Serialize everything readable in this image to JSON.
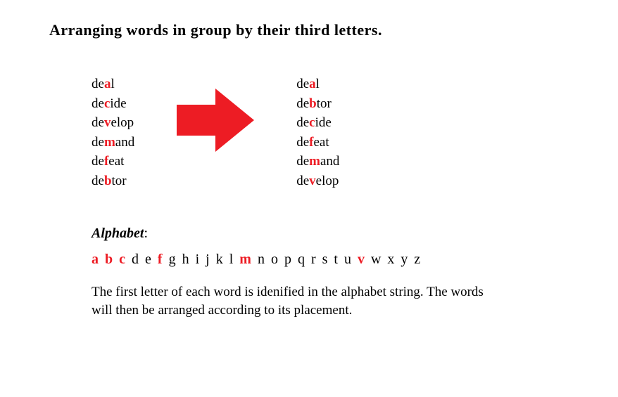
{
  "title": "Arranging words in group by their  third  letters.",
  "highlight_color": "#ED1C24",
  "left_words": [
    {
      "pre": "de",
      "hl": "a",
      "post": "l"
    },
    {
      "pre": "de",
      "hl": "c",
      "post": "ide"
    },
    {
      "pre": "de",
      "hl": "v",
      "post": "elop"
    },
    {
      "pre": "de",
      "hl": "m",
      "post": "and"
    },
    {
      "pre": "de",
      "hl": "f",
      "post": "eat"
    },
    {
      "pre": "de",
      "hl": "b",
      "post": "tor"
    }
  ],
  "right_words": [
    {
      "pre": "de",
      "hl": "a",
      "post": "l"
    },
    {
      "pre": "de",
      "hl": "b",
      "post": "tor"
    },
    {
      "pre": "de",
      "hl": "c",
      "post": "ide"
    },
    {
      "pre": "de",
      "hl": "f",
      "post": "eat"
    },
    {
      "pre": "de",
      "hl": "m",
      "post": "and"
    },
    {
      "pre": "de",
      "hl": "v",
      "post": "elop"
    }
  ],
  "alphabet_label": "Alphabet",
  "alphabet_colon": ":",
  "alphabet": [
    {
      "ch": "a",
      "hl": true
    },
    {
      "ch": "b",
      "hl": true
    },
    {
      "ch": "c",
      "hl": true
    },
    {
      "ch": "d",
      "hl": false
    },
    {
      "ch": "e",
      "hl": false
    },
    {
      "ch": "f",
      "hl": true
    },
    {
      "ch": "g",
      "hl": false
    },
    {
      "ch": "h",
      "hl": false
    },
    {
      "ch": "i",
      "hl": false
    },
    {
      "ch": "j",
      "hl": false
    },
    {
      "ch": "k",
      "hl": false
    },
    {
      "ch": "l",
      "hl": false
    },
    {
      "ch": "m",
      "hl": true
    },
    {
      "ch": "n",
      "hl": false
    },
    {
      "ch": "o",
      "hl": false
    },
    {
      "ch": "p",
      "hl": false
    },
    {
      "ch": "q",
      "hl": false
    },
    {
      "ch": "r",
      "hl": false
    },
    {
      "ch": "s",
      "hl": false
    },
    {
      "ch": "t",
      "hl": false
    },
    {
      "ch": "u",
      "hl": false
    },
    {
      "ch": "v",
      "hl": true
    },
    {
      "ch": "w",
      "hl": false
    },
    {
      "ch": "x",
      "hl": false
    },
    {
      "ch": "y",
      "hl": false
    },
    {
      "ch": "z",
      "hl": false
    }
  ],
  "body_text": "The first letter of each word is idenified in the alphabet string. The words will then be arranged according to its placement."
}
